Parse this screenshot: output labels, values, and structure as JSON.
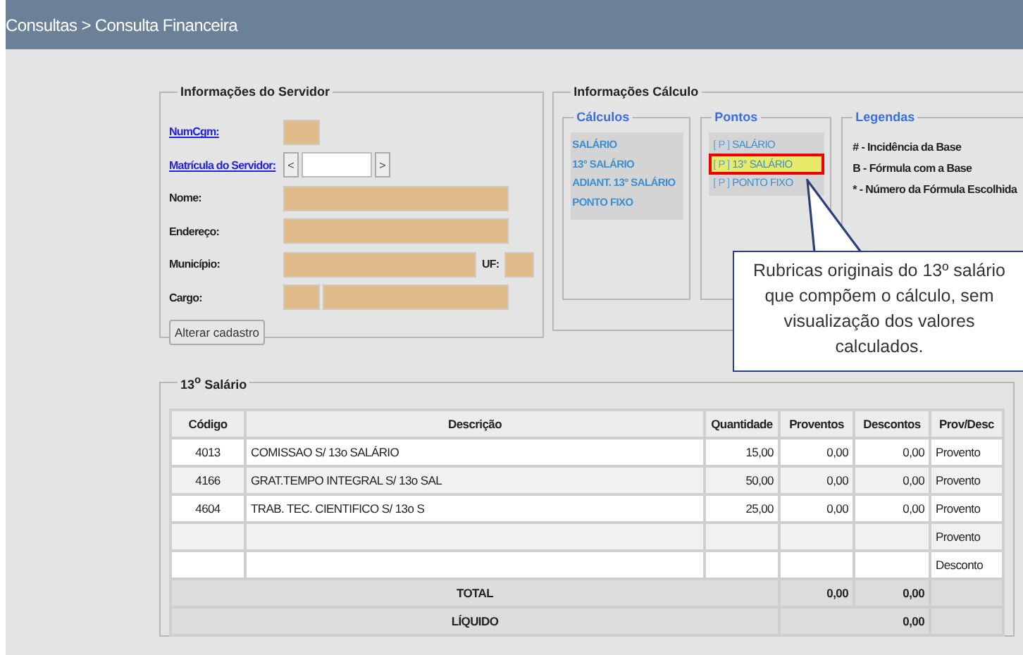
{
  "header": {
    "breadcrumb": "Consultas > Consulta Financeira"
  },
  "servidor": {
    "title": "Informações do Servidor",
    "fields": [
      {
        "label": "NumCgm:",
        "link": true,
        "kind": "short"
      },
      {
        "label": "Matrícula do Servidor:",
        "link": true,
        "kind": "stepper",
        "prev": "<",
        "next": ">"
      },
      {
        "label": "Nome:",
        "link": false,
        "kind": "wide"
      },
      {
        "label": "Endereço:",
        "link": false,
        "kind": "wide"
      },
      {
        "label": "Município:",
        "link": false,
        "kind": "city",
        "uf_label": "UF:"
      },
      {
        "label": "Cargo:",
        "link": false,
        "kind": "pair"
      }
    ],
    "button": "Alterar cadastro"
  },
  "calculo": {
    "title": "Informações Cálculo",
    "calculos": {
      "title": "Cálculos",
      "items": [
        "SALÁRIO",
        "13° SALÁRIO",
        "ADIANT. 13° SALÁRIO",
        "PONTO FIXO"
      ]
    },
    "pontos": {
      "title": "Pontos",
      "items": [
        {
          "prefix": "[ P ]",
          "label": "SALÁRIO",
          "highlighted": false
        },
        {
          "prefix": "[ P ]",
          "label": "13° SALÁRIO",
          "highlighted": true
        },
        {
          "prefix": "[ P ]",
          "label": "PONTO FIXO",
          "highlighted": false
        }
      ]
    },
    "legendas": {
      "title": "Legendas",
      "items": [
        "# - Incidência da Base",
        "B - Fórmula com a Base",
        "* - Número da Fórmula Escolhida"
      ]
    }
  },
  "callout": "Rubricas originais do 13º salário que compõem o cálculo, sem visualização dos valores calculados.",
  "salario": {
    "title": "13$^{o}$ Salário",
    "columns": [
      "Código",
      "Descrição",
      "Quantidade",
      "Proventos",
      "Descontos",
      "Prov/Desc"
    ],
    "rows": [
      {
        "codigo": "4013",
        "descricao": "COMISSAO S/ 13o SALÁRIO",
        "quantidade": "15,00",
        "proventos": "0,00",
        "descontos": "0,00",
        "prov_desc": "Provento"
      },
      {
        "codigo": "4166",
        "descricao": "GRAT.TEMPO INTEGRAL S/ 13o SAL",
        "quantidade": "50,00",
        "proventos": "0,00",
        "descontos": "0,00",
        "prov_desc": "Provento"
      },
      {
        "codigo": "4604",
        "descricao": "TRAB. TEC. CIENTIFICO S/ 13o S",
        "quantidade": "25,00",
        "proventos": "0,00",
        "descontos": "0,00",
        "prov_desc": "Provento"
      },
      {
        "prov_desc": "Provento"
      },
      {
        "prov_desc": "Desconto"
      }
    ],
    "total": {
      "label": "TOTAL",
      "proventos": "0,00",
      "descontos": "0,00"
    },
    "liquido": {
      "label": "LÍQUIDO",
      "value": "0,00"
    }
  }
}
